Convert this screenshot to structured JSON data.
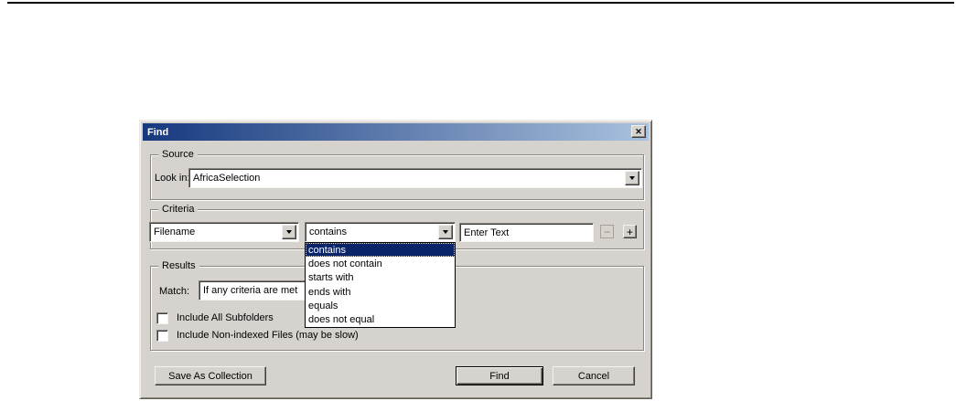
{
  "colors": {
    "dialog_bg": "#d6d3ce",
    "title_gradient_left": "#16387e",
    "title_gradient_right": "#a9c2de",
    "selection_bg": "#0a246a"
  },
  "icons": {
    "close": "✕",
    "minus": "−",
    "plus": "+"
  },
  "dialog": {
    "title": "Find",
    "source": {
      "legend": "Source",
      "look_in_label": "Look in:",
      "look_in_value": "AfricaSelection"
    },
    "criteria": {
      "legend": "Criteria",
      "field_value": "Filename",
      "operator_value": "contains",
      "operator_selected": "contains",
      "operator_options": [
        "contains",
        "does not contain",
        "starts with",
        "ends with",
        "equals",
        "does not equal"
      ],
      "text_value": "Enter Text"
    },
    "results": {
      "legend": "Results",
      "match_label": "Match:",
      "match_value": "If any criteria are met",
      "checkbox_subfolders": "Include All Subfolders",
      "checkbox_nonindexed": "Include Non-indexed Files (may be slow)"
    },
    "buttons": {
      "save": "Save As Collection",
      "find": "Find",
      "cancel": "Cancel"
    }
  }
}
